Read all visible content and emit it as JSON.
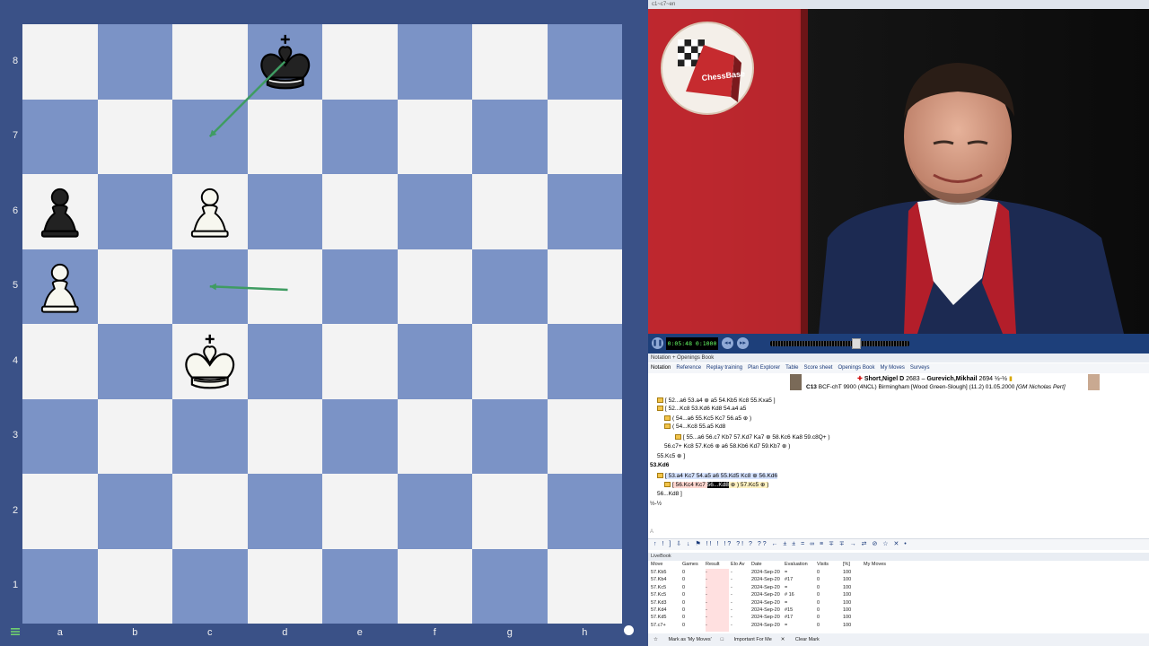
{
  "board": {
    "ranks": [
      "8",
      "7",
      "6",
      "5",
      "4",
      "3",
      "2",
      "1"
    ],
    "files": [
      "a",
      "b",
      "c",
      "d",
      "e",
      "f",
      "g",
      "h"
    ],
    "pieces": [
      {
        "square": "d8",
        "type": "king",
        "color": "black"
      },
      {
        "square": "a6",
        "type": "pawn",
        "color": "black"
      },
      {
        "square": "c6",
        "type": "pawn",
        "color": "white"
      },
      {
        "square": "a5",
        "type": "pawn",
        "color": "white"
      },
      {
        "square": "c4",
        "type": "king",
        "color": "white"
      }
    ],
    "arrows": [
      {
        "from": "d8",
        "to": "c7",
        "color": "#3f9c62"
      },
      {
        "from": "d4",
        "to": "c5",
        "color": "#3f9c62"
      }
    ],
    "colors": {
      "light": "#f3f3f3",
      "dark": "#7b93c6",
      "frame": "#3a5187"
    }
  },
  "video": {
    "window_title": "c1~c7~en",
    "logo_text": "ChessBase",
    "time": "0:05:48 0:1000",
    "seek_fraction": 0.62
  },
  "notation": {
    "pane_title": "Notation + Openings Book",
    "tabs": [
      "Notation",
      "Reference",
      "Replay training",
      "Plan Explorer",
      "Table",
      "Score sheet",
      "Openings Book",
      "My Moves",
      "Surveys"
    ],
    "white_player": "Short,Nigel D",
    "white_elo": "2683",
    "black_player": "Gurevich,Mikhail",
    "black_elo": "2694",
    "result": "½-½",
    "eco": "C13",
    "event": "BCF-chT 9900 (4NCL) Birmingham [Wood Green-Slough] (11.2) 01.05.2000",
    "annotator": "[GM Nicholas Pert]",
    "lines": [
      "[ 52...a6  53.a4  ⊕  a5  54.Kb5  Kc8  55.Kxa5 ]",
      "[ 52...Kc8  53.Kd6  Kd8  54.a4  a5",
      "( 54...a6  55.Kc5  Kc7  56.a5  ⊕ )",
      "( 54...Kc8  55.a5  Kd8",
      "[ 55...a6  56.c7  Kb7  57.Kd7  Ka7  ⊕  58.Kc6  Ka8  59.c8Q+ )",
      "56.c7+  Kc8  57.Kc6  ⊕  a6  58.Kb6  Kd7  59.Kb7  ⊕ )",
      "55.Kc5  ⊕ ]",
      "53.Kd6",
      "[ 53.a4  Kc7  54.a5  a6  55.Kd5  Kc8  ⊕  56.Kd6",
      "[ 56.Kc4  Kc7  56...Kd8  ⊕ ) 57.Kc5  ⊕ )",
      "56...Kd8 ]",
      "½-½"
    ],
    "input_placeholder": "A",
    "symbols": "↑ ! ] ⇩ ↓ ⚑ !! ! !? ?! ? ?? ← ± ± = ∞ ≡ ∓ ∓ → ⇄ ⊘ ☆ ✕ •"
  },
  "live_book": {
    "title": "LiveBook",
    "columns": [
      "Move",
      "Games",
      "Result",
      "Elo Av",
      "Date",
      "Evaluation",
      "Visits",
      "[%]",
      "My Moves"
    ],
    "rows": [
      [
        "57.Kb5",
        "0",
        "-",
        "-",
        "2024-Sep-20",
        "=",
        "0",
        "100",
        ""
      ],
      [
        "57.Kb4",
        "0",
        "-",
        "-",
        "2024-Sep-20",
        "#17",
        "0",
        "100",
        ""
      ],
      [
        "57.Kc5",
        "0",
        "-",
        "-",
        "2024-Sep-20",
        "=",
        "0",
        "100",
        ""
      ],
      [
        "57.Kc5",
        "0",
        "-",
        "-",
        "2024-Sep-20",
        "# 16",
        "0",
        "100",
        ""
      ],
      [
        "57.Kd3",
        "0",
        "-",
        "-",
        "2024-Sep-20",
        "=",
        "0",
        "100",
        ""
      ],
      [
        "57.Kd4",
        "0",
        "-",
        "-",
        "2024-Sep-20",
        "#15",
        "0",
        "100",
        ""
      ],
      [
        "57.Kd5",
        "0",
        "-",
        "-",
        "2024-Sep-20",
        "#17",
        "0",
        "100",
        ""
      ],
      [
        "57.c7+",
        "0",
        "-",
        "-",
        "2024-Sep-20",
        "=",
        "0",
        "100",
        ""
      ]
    ],
    "footer": [
      "Mark as 'My Moves'",
      "Important For Me",
      "Clear Mark"
    ]
  }
}
